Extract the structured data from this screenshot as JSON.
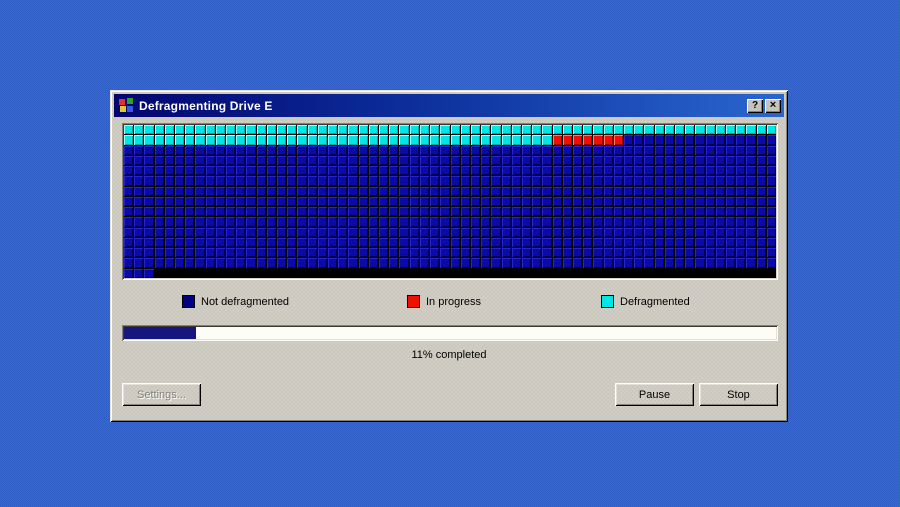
{
  "window": {
    "title": "Defragmenting Drive E",
    "help_button_glyph": "?",
    "close_button_glyph": "×"
  },
  "grid": {
    "columns": 64,
    "rows": [
      {
        "repeat": 1,
        "segments": [
          [
            "defragmented",
            64
          ]
        ]
      },
      {
        "repeat": 1,
        "segments": [
          [
            "defragmented",
            42
          ],
          [
            "in_progress",
            7
          ],
          [
            "not_defragmented",
            15
          ]
        ]
      },
      {
        "repeat": 12,
        "segments": [
          [
            "not_defragmented",
            64
          ]
        ]
      },
      {
        "repeat": 1,
        "segments": [
          [
            "not_defragmented",
            3
          ],
          [
            "empty",
            61
          ]
        ]
      }
    ]
  },
  "legend": {
    "items": [
      {
        "key": "not_defragmented",
        "label": "Not defragmented"
      },
      {
        "key": "in_progress",
        "label": "In progress"
      },
      {
        "key": "defragmented",
        "label": "Defragmented"
      }
    ]
  },
  "progress": {
    "percent": 11,
    "label": "11% completed"
  },
  "buttons": {
    "settings": "Settings...",
    "pause": "Pause",
    "stop": "Stop"
  },
  "colors": {
    "defragmented": "#00e6e6",
    "in_progress": "#ee1005",
    "not_defragmented": "#0a0aa6",
    "legend_not_defragmented": "#000080",
    "legend_in_progress": "#ee1005",
    "legend_defragmented": "#00e6e6",
    "progress_fill": "#16167e",
    "titlebar_left": "#03056e",
    "titlebar_right": "#2a66cf",
    "desktop_checker_a": "#1f9146",
    "desktop_checker_b": "#2e5ec6"
  }
}
